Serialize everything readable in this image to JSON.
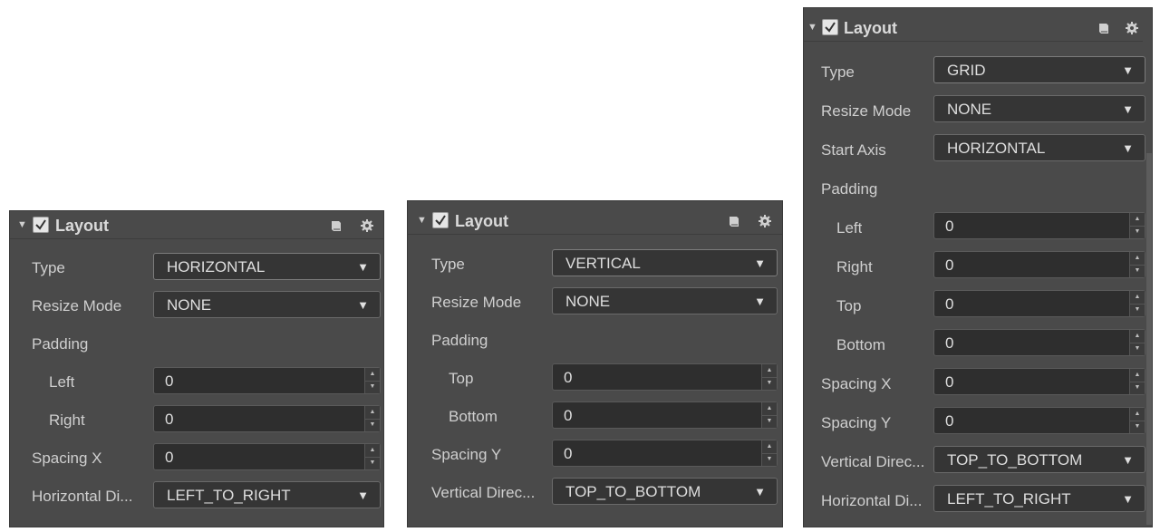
{
  "panels": [
    {
      "title": "Layout",
      "type": {
        "label": "Type",
        "value": "HORIZONTAL"
      },
      "resize_mode": {
        "label": "Resize Mode",
        "value": "NONE"
      },
      "padding_label": "Padding",
      "padding": [
        {
          "label": "Left",
          "value": "0"
        },
        {
          "label": "Right",
          "value": "0"
        }
      ],
      "spacing": {
        "label": "Spacing X",
        "value": "0"
      },
      "direction": {
        "label": "Horizontal Di...",
        "value": "LEFT_TO_RIGHT"
      }
    },
    {
      "title": "Layout",
      "type": {
        "label": "Type",
        "value": "VERTICAL"
      },
      "resize_mode": {
        "label": "Resize Mode",
        "value": "NONE"
      },
      "padding_label": "Padding",
      "padding": [
        {
          "label": "Top",
          "value": "0"
        },
        {
          "label": "Bottom",
          "value": "0"
        }
      ],
      "spacing": {
        "label": "Spacing Y",
        "value": "0"
      },
      "direction": {
        "label": "Vertical Direc...",
        "value": "TOP_TO_BOTTOM"
      }
    },
    {
      "title": "Layout",
      "type": {
        "label": "Type",
        "value": "GRID"
      },
      "resize_mode": {
        "label": "Resize Mode",
        "value": "NONE"
      },
      "start_axis": {
        "label": "Start Axis",
        "value": "HORIZONTAL"
      },
      "padding_label": "Padding",
      "padding": [
        {
          "label": "Left",
          "value": "0"
        },
        {
          "label": "Right",
          "value": "0"
        },
        {
          "label": "Top",
          "value": "0"
        },
        {
          "label": "Bottom",
          "value": "0"
        }
      ],
      "spacing_x": {
        "label": "Spacing X",
        "value": "0"
      },
      "spacing_y": {
        "label": "Spacing Y",
        "value": "0"
      },
      "vertical_direction": {
        "label": "Vertical Direc...",
        "value": "TOP_TO_BOTTOM"
      },
      "horizontal_direction": {
        "label": "Horizontal Di...",
        "value": "LEFT_TO_RIGHT"
      }
    }
  ],
  "icons": {
    "collapse": "triangle-down-icon",
    "enabled": "checkmark-icon",
    "help": "book-icon",
    "settings": "gear-icon"
  },
  "colors": {
    "panel_bg": "#4a4a4a",
    "field_bg": "#2e2e2e",
    "text": "#cfcfcf"
  }
}
